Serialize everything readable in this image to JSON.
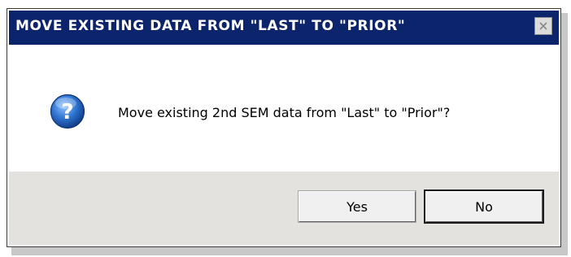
{
  "dialog": {
    "title": "MOVE EXISTING DATA FROM \"LAST\" TO \"PRIOR\"",
    "message": "Move existing 2nd SEM data from \"Last\" to \"Prior\"?",
    "icon": "question-icon",
    "close_icon": "close-icon"
  },
  "buttons": {
    "yes_label": "Yes",
    "no_label": "No"
  },
  "colors": {
    "titlebar": "#0b246b",
    "footer": "#e4e2de",
    "icon_blue": "#1f5fb8"
  }
}
